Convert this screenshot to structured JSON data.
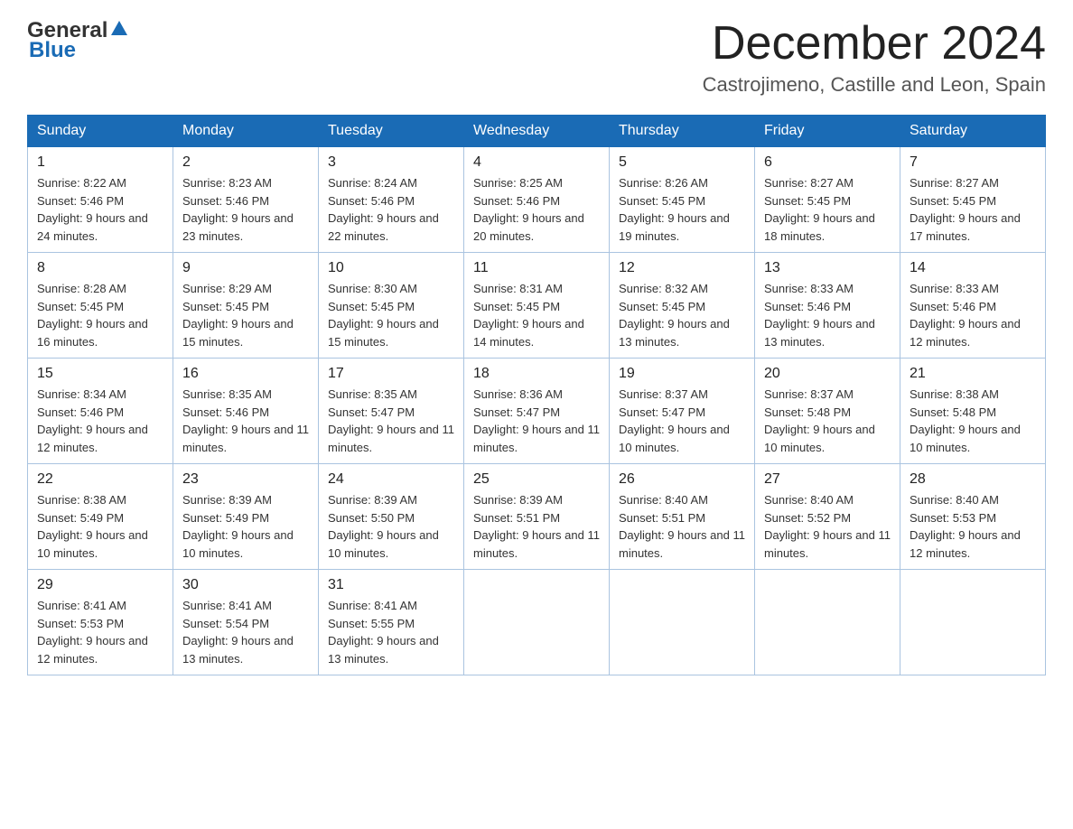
{
  "header": {
    "logo_general": "General",
    "logo_blue": "Blue",
    "month_title": "December 2024",
    "location": "Castrojimeno, Castille and Leon, Spain"
  },
  "weekdays": [
    "Sunday",
    "Monday",
    "Tuesday",
    "Wednesday",
    "Thursday",
    "Friday",
    "Saturday"
  ],
  "weeks": [
    [
      {
        "day": "1",
        "sunrise": "8:22 AM",
        "sunset": "5:46 PM",
        "daylight": "9 hours and 24 minutes."
      },
      {
        "day": "2",
        "sunrise": "8:23 AM",
        "sunset": "5:46 PM",
        "daylight": "9 hours and 23 minutes."
      },
      {
        "day": "3",
        "sunrise": "8:24 AM",
        "sunset": "5:46 PM",
        "daylight": "9 hours and 22 minutes."
      },
      {
        "day": "4",
        "sunrise": "8:25 AM",
        "sunset": "5:46 PM",
        "daylight": "9 hours and 20 minutes."
      },
      {
        "day": "5",
        "sunrise": "8:26 AM",
        "sunset": "5:45 PM",
        "daylight": "9 hours and 19 minutes."
      },
      {
        "day": "6",
        "sunrise": "8:27 AM",
        "sunset": "5:45 PM",
        "daylight": "9 hours and 18 minutes."
      },
      {
        "day": "7",
        "sunrise": "8:27 AM",
        "sunset": "5:45 PM",
        "daylight": "9 hours and 17 minutes."
      }
    ],
    [
      {
        "day": "8",
        "sunrise": "8:28 AM",
        "sunset": "5:45 PM",
        "daylight": "9 hours and 16 minutes."
      },
      {
        "day": "9",
        "sunrise": "8:29 AM",
        "sunset": "5:45 PM",
        "daylight": "9 hours and 15 minutes."
      },
      {
        "day": "10",
        "sunrise": "8:30 AM",
        "sunset": "5:45 PM",
        "daylight": "9 hours and 15 minutes."
      },
      {
        "day": "11",
        "sunrise": "8:31 AM",
        "sunset": "5:45 PM",
        "daylight": "9 hours and 14 minutes."
      },
      {
        "day": "12",
        "sunrise": "8:32 AM",
        "sunset": "5:45 PM",
        "daylight": "9 hours and 13 minutes."
      },
      {
        "day": "13",
        "sunrise": "8:33 AM",
        "sunset": "5:46 PM",
        "daylight": "9 hours and 13 minutes."
      },
      {
        "day": "14",
        "sunrise": "8:33 AM",
        "sunset": "5:46 PM",
        "daylight": "9 hours and 12 minutes."
      }
    ],
    [
      {
        "day": "15",
        "sunrise": "8:34 AM",
        "sunset": "5:46 PM",
        "daylight": "9 hours and 12 minutes."
      },
      {
        "day": "16",
        "sunrise": "8:35 AM",
        "sunset": "5:46 PM",
        "daylight": "9 hours and 11 minutes."
      },
      {
        "day": "17",
        "sunrise": "8:35 AM",
        "sunset": "5:47 PM",
        "daylight": "9 hours and 11 minutes."
      },
      {
        "day": "18",
        "sunrise": "8:36 AM",
        "sunset": "5:47 PM",
        "daylight": "9 hours and 11 minutes."
      },
      {
        "day": "19",
        "sunrise": "8:37 AM",
        "sunset": "5:47 PM",
        "daylight": "9 hours and 10 minutes."
      },
      {
        "day": "20",
        "sunrise": "8:37 AM",
        "sunset": "5:48 PM",
        "daylight": "9 hours and 10 minutes."
      },
      {
        "day": "21",
        "sunrise": "8:38 AM",
        "sunset": "5:48 PM",
        "daylight": "9 hours and 10 minutes."
      }
    ],
    [
      {
        "day": "22",
        "sunrise": "8:38 AM",
        "sunset": "5:49 PM",
        "daylight": "9 hours and 10 minutes."
      },
      {
        "day": "23",
        "sunrise": "8:39 AM",
        "sunset": "5:49 PM",
        "daylight": "9 hours and 10 minutes."
      },
      {
        "day": "24",
        "sunrise": "8:39 AM",
        "sunset": "5:50 PM",
        "daylight": "9 hours and 10 minutes."
      },
      {
        "day": "25",
        "sunrise": "8:39 AM",
        "sunset": "5:51 PM",
        "daylight": "9 hours and 11 minutes."
      },
      {
        "day": "26",
        "sunrise": "8:40 AM",
        "sunset": "5:51 PM",
        "daylight": "9 hours and 11 minutes."
      },
      {
        "day": "27",
        "sunrise": "8:40 AM",
        "sunset": "5:52 PM",
        "daylight": "9 hours and 11 minutes."
      },
      {
        "day": "28",
        "sunrise": "8:40 AM",
        "sunset": "5:53 PM",
        "daylight": "9 hours and 12 minutes."
      }
    ],
    [
      {
        "day": "29",
        "sunrise": "8:41 AM",
        "sunset": "5:53 PM",
        "daylight": "9 hours and 12 minutes."
      },
      {
        "day": "30",
        "sunrise": "8:41 AM",
        "sunset": "5:54 PM",
        "daylight": "9 hours and 13 minutes."
      },
      {
        "day": "31",
        "sunrise": "8:41 AM",
        "sunset": "5:55 PM",
        "daylight": "9 hours and 13 minutes."
      },
      null,
      null,
      null,
      null
    ]
  ]
}
